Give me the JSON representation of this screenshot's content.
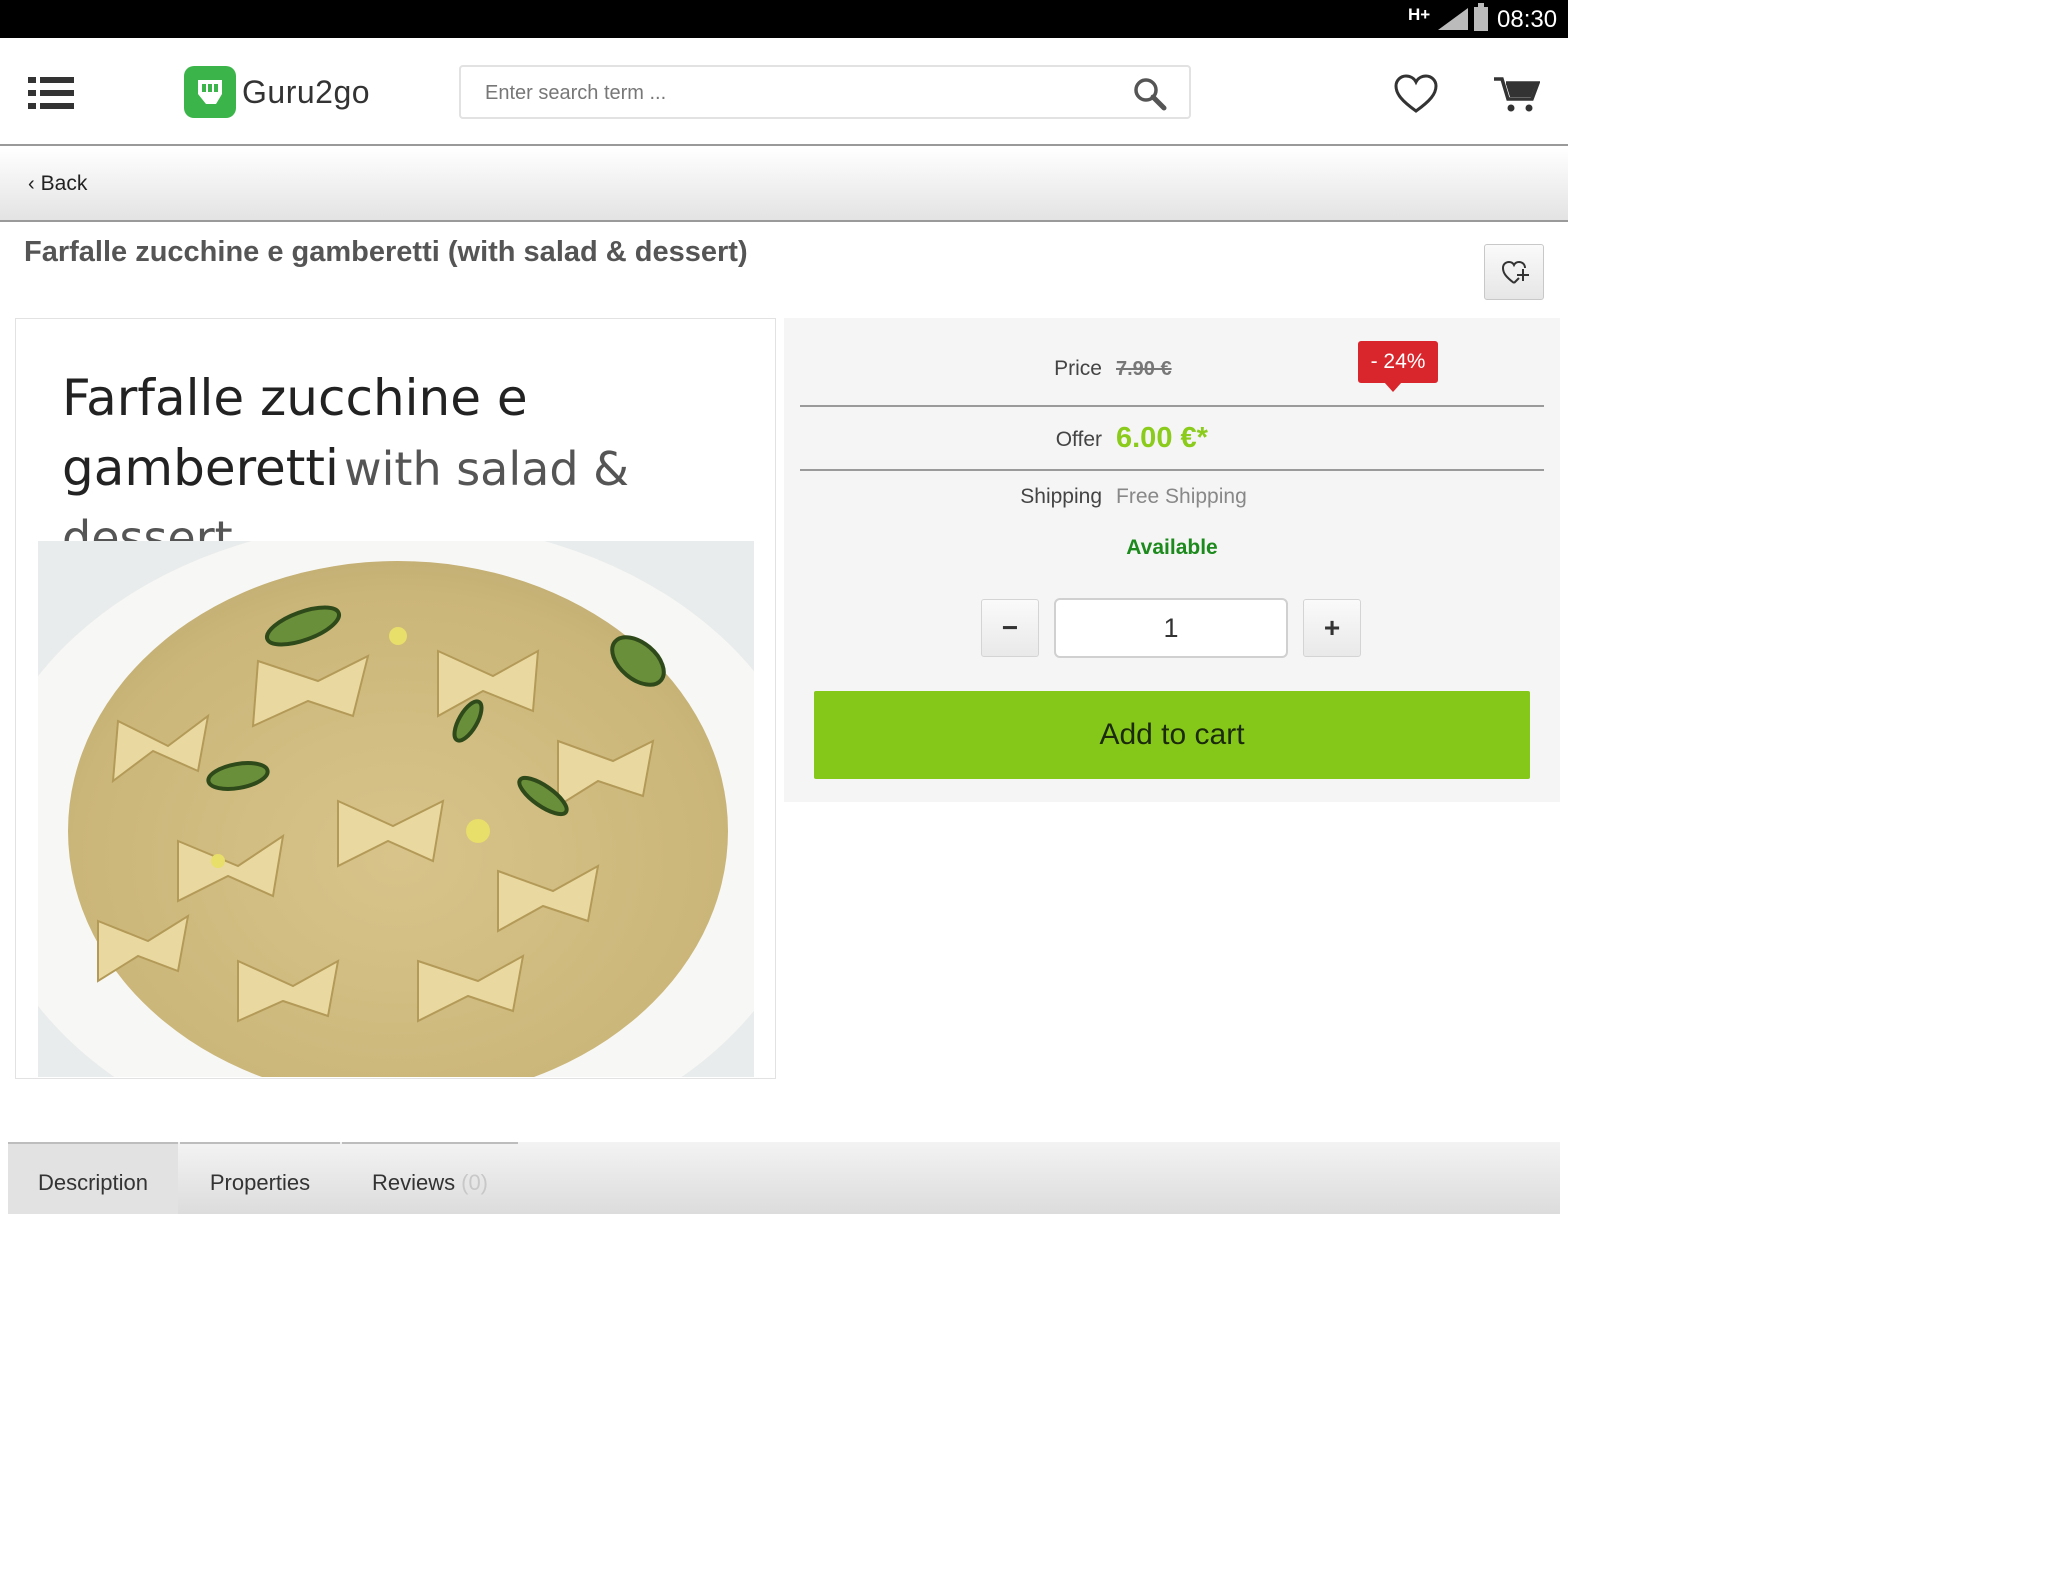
{
  "status_bar": {
    "network": "H+",
    "time": "08:30",
    "icons": [
      "signal-icon",
      "battery-icon"
    ]
  },
  "header": {
    "logo_text": "Guru2go",
    "search_placeholder": "Enter search term ...",
    "icons": [
      "menu-icon",
      "search-icon",
      "heart-icon",
      "cart-icon"
    ],
    "brand_color": "#3bb54a"
  },
  "nav": {
    "back_label": "Back"
  },
  "product": {
    "title": "Farfalle zucchine e gamberetti (with salad & dessert)",
    "image_caption_main": "Farfalle zucchine e gamberetti",
    "image_caption_sub": "with salad & dessert",
    "price_label": "Price",
    "price_old": "7.90 €",
    "discount_badge": "- 24%",
    "offer_label": "Offer",
    "offer_price": "6.00 €*",
    "shipping_label": "Shipping",
    "shipping_value": "Free Shipping",
    "availability": "Available",
    "quantity": "1",
    "qty_minus": "−",
    "qty_plus": "+",
    "add_to_cart": "Add to cart",
    "colors": {
      "offer": "#8acb1b",
      "badge": "#d9262c",
      "availability": "#1d8a1d",
      "cart_button": "#86c81a"
    }
  },
  "tabs": [
    {
      "label": "Description",
      "active": true
    },
    {
      "label": "Properties",
      "active": false
    },
    {
      "label": "Reviews",
      "count": "(0)",
      "active": false
    }
  ]
}
